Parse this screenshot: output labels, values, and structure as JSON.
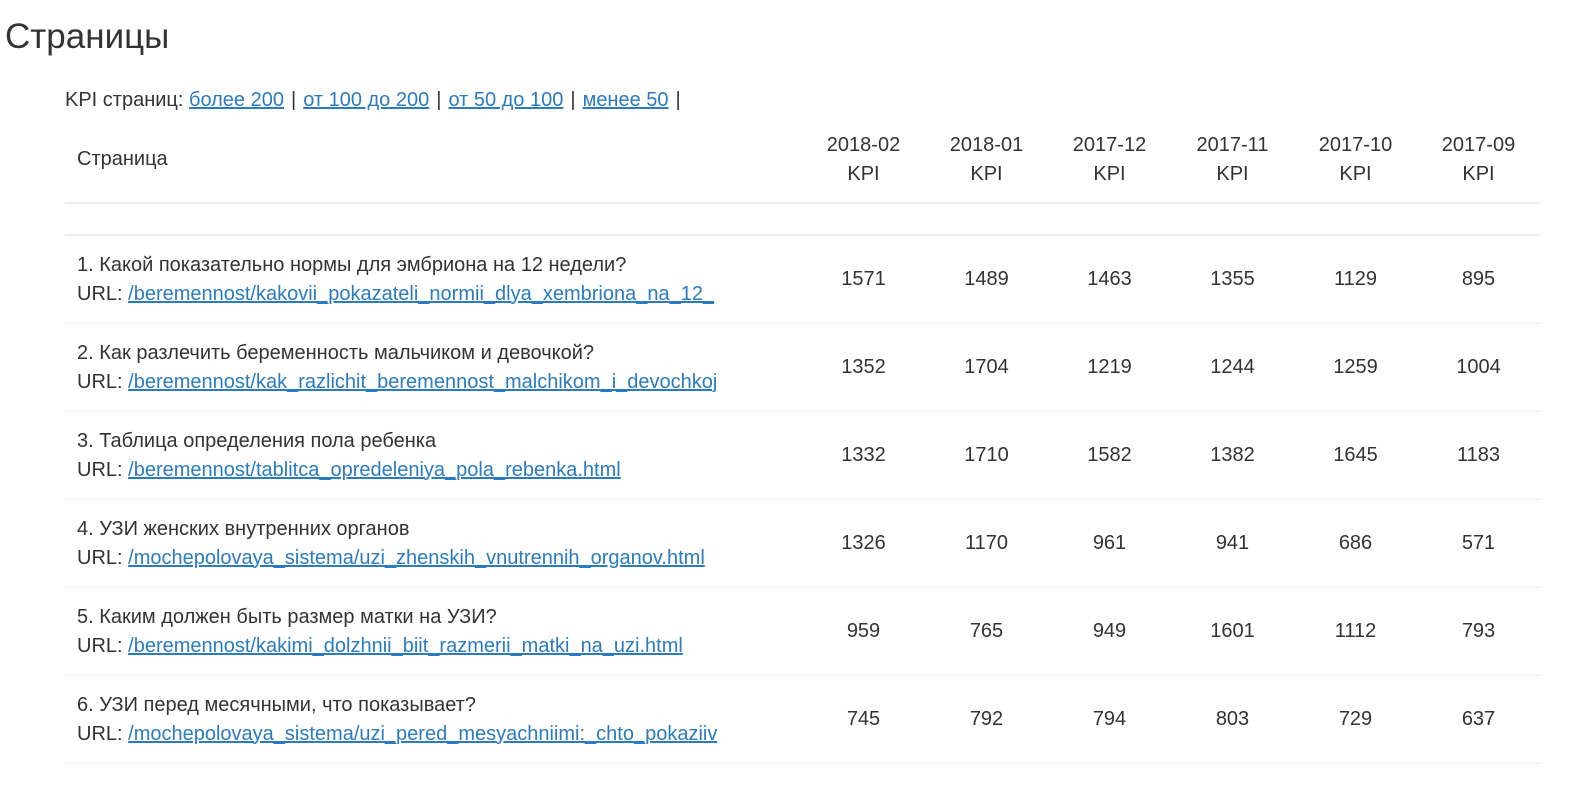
{
  "page_title": "Страницы",
  "filters": {
    "label": "KPI страниц:",
    "separator": "|",
    "links": [
      "более 200",
      "от 100 до 200",
      "от 50 до 100",
      "менее 50"
    ]
  },
  "table": {
    "page_header": "Страница",
    "url_prefix": "URL:",
    "columns": [
      {
        "period": "2018-02",
        "metric": "KPI"
      },
      {
        "period": "2018-01",
        "metric": "KPI"
      },
      {
        "period": "2017-12",
        "metric": "KPI"
      },
      {
        "period": "2017-11",
        "metric": "KPI"
      },
      {
        "period": "2017-10",
        "metric": "KPI"
      },
      {
        "period": "2017-09",
        "metric": "KPI"
      }
    ],
    "rows": [
      {
        "title": "1. Какой показательно нормы для эмбриона на 12 недели?",
        "url": "/beremennost/kakovii_pokazateli_normii_dlya_xembriona_na_12_",
        "values": [
          "1571",
          "1489",
          "1463",
          "1355",
          "1129",
          "895"
        ]
      },
      {
        "title": "2. Как разлечить беременность мальчиком и девочкой?",
        "url": "/beremennost/kak_razlichit_beremennost_malchikom_i_devochkoj",
        "values": [
          "1352",
          "1704",
          "1219",
          "1244",
          "1259",
          "1004"
        ]
      },
      {
        "title": "3. Таблица определения пола ребенка",
        "url": "/beremennost/tablitca_opredeleniya_pola_rebenka.html",
        "values": [
          "1332",
          "1710",
          "1582",
          "1382",
          "1645",
          "1183"
        ]
      },
      {
        "title": "4. УЗИ женских внутренних органов",
        "url": "/mochepolovaya_sistema/uzi_zhenskih_vnutrennih_organov.html",
        "values": [
          "1326",
          "1170",
          "961",
          "941",
          "686",
          "571"
        ]
      },
      {
        "title": "5. Каким должен быть размер матки на УЗИ?",
        "url": "/beremennost/kakimi_dolzhnii_biit_razmerii_matki_na_uzi.html",
        "values": [
          "959",
          "765",
          "949",
          "1601",
          "1112",
          "793"
        ]
      },
      {
        "title": "6. УЗИ перед месячными, что показывает?",
        "url": "/mochepolovaya_sistema/uzi_pered_mesyachniimi:_chto_pokaziiv",
        "values": [
          "745",
          "792",
          "794",
          "803",
          "729",
          "637"
        ]
      }
    ]
  },
  "colors": {
    "text": "#333333",
    "link": "#2a7bc0",
    "divider": "#eeeeee"
  }
}
